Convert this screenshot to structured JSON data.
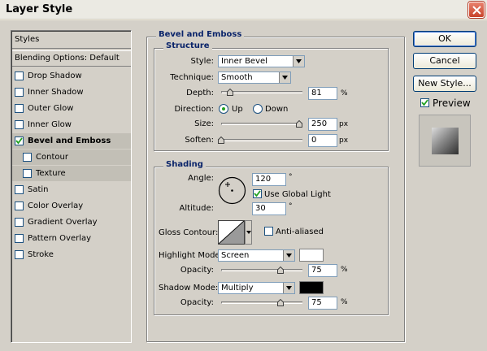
{
  "window": {
    "title": "Layer Style"
  },
  "styles_panel": {
    "header": "Styles",
    "blending": "Blending Options: Default",
    "items": [
      {
        "label": "Drop Shadow",
        "checked": false
      },
      {
        "label": "Inner Shadow",
        "checked": false
      },
      {
        "label": "Outer Glow",
        "checked": false
      },
      {
        "label": "Inner Glow",
        "checked": false
      },
      {
        "label": "Bevel and Emboss",
        "checked": true
      },
      {
        "label": "Contour",
        "checked": false
      },
      {
        "label": "Texture",
        "checked": false
      },
      {
        "label": "Satin",
        "checked": false
      },
      {
        "label": "Color Overlay",
        "checked": false
      },
      {
        "label": "Gradient Overlay",
        "checked": false
      },
      {
        "label": "Pattern Overlay",
        "checked": false
      },
      {
        "label": "Stroke",
        "checked": false
      }
    ]
  },
  "main": {
    "title": "Bevel and Emboss",
    "structure": {
      "title": "Structure",
      "style_label": "Style:",
      "style_value": "Inner Bevel",
      "technique_label": "Technique:",
      "technique_value": "Smooth",
      "depth_label": "Depth:",
      "depth_value": "81",
      "depth_unit": "%",
      "depth_fraction": 0.08,
      "direction_label": "Direction:",
      "direction_up": "Up",
      "direction_down": "Down",
      "size_label": "Size:",
      "size_value": "250",
      "size_unit": "px",
      "size_fraction": 1.0,
      "soften_label": "Soften:",
      "soften_value": "0",
      "soften_unit": "px",
      "soften_fraction": 0.0
    },
    "shading": {
      "title": "Shading",
      "angle_label": "Angle:",
      "angle_value": "120",
      "degree": "°",
      "use_global_light": "Use Global Light",
      "altitude_label": "Altitude:",
      "altitude_value": "30",
      "gloss_contour_label": "Gloss Contour:",
      "anti_aliased": "Anti-aliased",
      "highlight_mode_label": "Highlight Mode:",
      "highlight_mode_value": "Screen",
      "highlight_color": "#ffffff",
      "opacity_label": "Opacity:",
      "highlight_opacity": "75",
      "highlight_opacity_fraction": 0.75,
      "shadow_mode_label": "Shadow Mode:",
      "shadow_mode_value": "Multiply",
      "shadow_color": "#000000",
      "shadow_opacity": "75",
      "shadow_opacity_fraction": 0.75,
      "percent": "%"
    }
  },
  "buttons": {
    "ok": "OK",
    "cancel": "Cancel",
    "new_style": "New Style...",
    "preview": "Preview"
  }
}
